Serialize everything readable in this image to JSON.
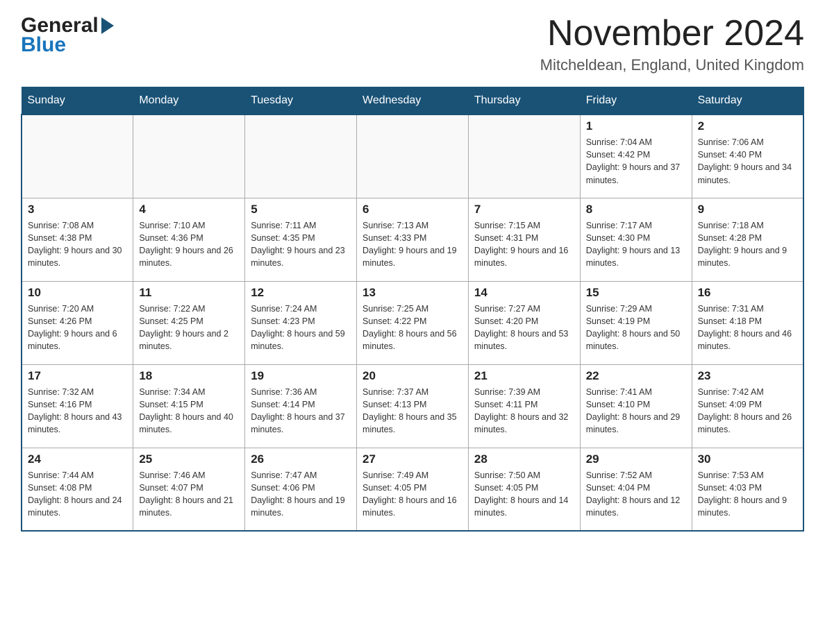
{
  "header": {
    "month_title": "November 2024",
    "location": "Mitcheldean, England, United Kingdom",
    "logo_general": "General",
    "logo_blue": "Blue"
  },
  "days_of_week": [
    "Sunday",
    "Monday",
    "Tuesday",
    "Wednesday",
    "Thursday",
    "Friday",
    "Saturday"
  ],
  "weeks": [
    [
      {
        "num": "",
        "info": ""
      },
      {
        "num": "",
        "info": ""
      },
      {
        "num": "",
        "info": ""
      },
      {
        "num": "",
        "info": ""
      },
      {
        "num": "",
        "info": ""
      },
      {
        "num": "1",
        "info": "Sunrise: 7:04 AM\nSunset: 4:42 PM\nDaylight: 9 hours and 37 minutes."
      },
      {
        "num": "2",
        "info": "Sunrise: 7:06 AM\nSunset: 4:40 PM\nDaylight: 9 hours and 34 minutes."
      }
    ],
    [
      {
        "num": "3",
        "info": "Sunrise: 7:08 AM\nSunset: 4:38 PM\nDaylight: 9 hours and 30 minutes."
      },
      {
        "num": "4",
        "info": "Sunrise: 7:10 AM\nSunset: 4:36 PM\nDaylight: 9 hours and 26 minutes."
      },
      {
        "num": "5",
        "info": "Sunrise: 7:11 AM\nSunset: 4:35 PM\nDaylight: 9 hours and 23 minutes."
      },
      {
        "num": "6",
        "info": "Sunrise: 7:13 AM\nSunset: 4:33 PM\nDaylight: 9 hours and 19 minutes."
      },
      {
        "num": "7",
        "info": "Sunrise: 7:15 AM\nSunset: 4:31 PM\nDaylight: 9 hours and 16 minutes."
      },
      {
        "num": "8",
        "info": "Sunrise: 7:17 AM\nSunset: 4:30 PM\nDaylight: 9 hours and 13 minutes."
      },
      {
        "num": "9",
        "info": "Sunrise: 7:18 AM\nSunset: 4:28 PM\nDaylight: 9 hours and 9 minutes."
      }
    ],
    [
      {
        "num": "10",
        "info": "Sunrise: 7:20 AM\nSunset: 4:26 PM\nDaylight: 9 hours and 6 minutes."
      },
      {
        "num": "11",
        "info": "Sunrise: 7:22 AM\nSunset: 4:25 PM\nDaylight: 9 hours and 2 minutes."
      },
      {
        "num": "12",
        "info": "Sunrise: 7:24 AM\nSunset: 4:23 PM\nDaylight: 8 hours and 59 minutes."
      },
      {
        "num": "13",
        "info": "Sunrise: 7:25 AM\nSunset: 4:22 PM\nDaylight: 8 hours and 56 minutes."
      },
      {
        "num": "14",
        "info": "Sunrise: 7:27 AM\nSunset: 4:20 PM\nDaylight: 8 hours and 53 minutes."
      },
      {
        "num": "15",
        "info": "Sunrise: 7:29 AM\nSunset: 4:19 PM\nDaylight: 8 hours and 50 minutes."
      },
      {
        "num": "16",
        "info": "Sunrise: 7:31 AM\nSunset: 4:18 PM\nDaylight: 8 hours and 46 minutes."
      }
    ],
    [
      {
        "num": "17",
        "info": "Sunrise: 7:32 AM\nSunset: 4:16 PM\nDaylight: 8 hours and 43 minutes."
      },
      {
        "num": "18",
        "info": "Sunrise: 7:34 AM\nSunset: 4:15 PM\nDaylight: 8 hours and 40 minutes."
      },
      {
        "num": "19",
        "info": "Sunrise: 7:36 AM\nSunset: 4:14 PM\nDaylight: 8 hours and 37 minutes."
      },
      {
        "num": "20",
        "info": "Sunrise: 7:37 AM\nSunset: 4:13 PM\nDaylight: 8 hours and 35 minutes."
      },
      {
        "num": "21",
        "info": "Sunrise: 7:39 AM\nSunset: 4:11 PM\nDaylight: 8 hours and 32 minutes."
      },
      {
        "num": "22",
        "info": "Sunrise: 7:41 AM\nSunset: 4:10 PM\nDaylight: 8 hours and 29 minutes."
      },
      {
        "num": "23",
        "info": "Sunrise: 7:42 AM\nSunset: 4:09 PM\nDaylight: 8 hours and 26 minutes."
      }
    ],
    [
      {
        "num": "24",
        "info": "Sunrise: 7:44 AM\nSunset: 4:08 PM\nDaylight: 8 hours and 24 minutes."
      },
      {
        "num": "25",
        "info": "Sunrise: 7:46 AM\nSunset: 4:07 PM\nDaylight: 8 hours and 21 minutes."
      },
      {
        "num": "26",
        "info": "Sunrise: 7:47 AM\nSunset: 4:06 PM\nDaylight: 8 hours and 19 minutes."
      },
      {
        "num": "27",
        "info": "Sunrise: 7:49 AM\nSunset: 4:05 PM\nDaylight: 8 hours and 16 minutes."
      },
      {
        "num": "28",
        "info": "Sunrise: 7:50 AM\nSunset: 4:05 PM\nDaylight: 8 hours and 14 minutes."
      },
      {
        "num": "29",
        "info": "Sunrise: 7:52 AM\nSunset: 4:04 PM\nDaylight: 8 hours and 12 minutes."
      },
      {
        "num": "30",
        "info": "Sunrise: 7:53 AM\nSunset: 4:03 PM\nDaylight: 8 hours and 9 minutes."
      }
    ]
  ]
}
